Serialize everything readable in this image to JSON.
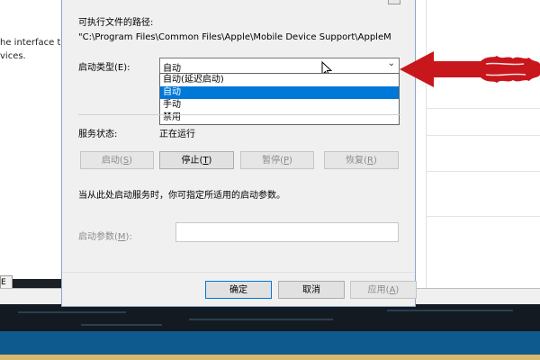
{
  "background": {
    "left_text_lines": [
      "he interface to",
      "vices."
    ],
    "left_tab_label": "E"
  },
  "dialog": {
    "path_label": "可执行文件的路径:",
    "path_value": "\"C:\\Program Files\\Common Files\\Apple\\Mobile Device Support\\AppleM",
    "startup_type_label": "启动类型(E):",
    "startup_type_value": "自动",
    "dropdown_options": [
      {
        "label": "自动(延迟启动)",
        "selected": false
      },
      {
        "label": "自动",
        "selected": true
      },
      {
        "label": "手动",
        "selected": false
      },
      {
        "label": "禁用",
        "selected": false
      }
    ],
    "service_status_label": "服务状态:",
    "service_status_value": "正在运行",
    "buttons": {
      "start": "启动(",
      "start_key": "S",
      "stop": "停止(",
      "stop_key": "T",
      "pause": "暂停(",
      "pause_key": "P",
      "resume": "恢复(",
      "resume_key": "R",
      "close_paren": ")"
    },
    "hint": "当从此处启动服务时，你可指定所适用的启动参数。",
    "start_params_label": "启动参数(",
    "start_params_key": "M",
    "start_params_suffix": "):",
    "start_params_value": "",
    "ok": "确定",
    "cancel": "取消",
    "apply": "应用(",
    "apply_key": "A",
    "apply_suffix": ")"
  },
  "colors": {
    "selection": "#0078d7",
    "arrow": "#c8161d",
    "dialog_bg": "#f0f0f0"
  }
}
